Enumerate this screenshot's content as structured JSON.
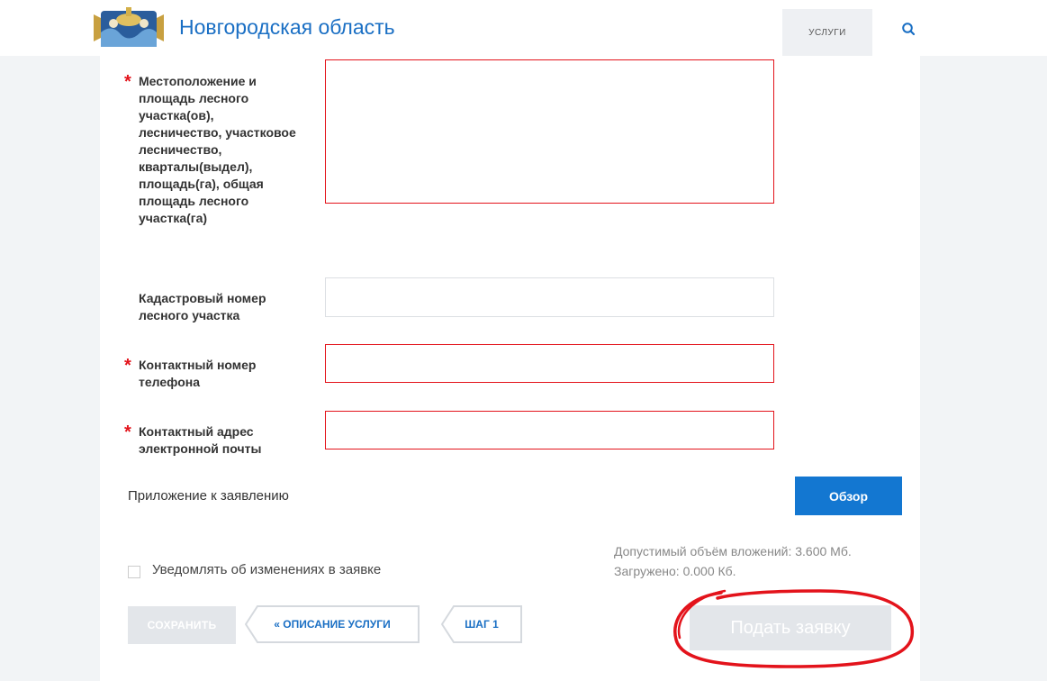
{
  "header": {
    "title": "Новгородская область",
    "services_label": "услуги",
    "logo_icon": "coat-of-arms-icon",
    "search_icon": "search-icon",
    "accent_color": "#1a6fc4"
  },
  "form": {
    "fields": [
      {
        "label": "Местоположение и площадь лесного участка(ов), лесничество, участковое лесничество, кварталы(выдел), площадь(га), общая площадь лесного участка(га)",
        "required": true,
        "value": ""
      },
      {
        "label": "Кадастровый номер лесного участка",
        "required": false,
        "value": ""
      },
      {
        "label": "Контактный номер телефона",
        "required": true,
        "value": ""
      },
      {
        "label": "Контактный адрес электронной почты",
        "required": true,
        "value": ""
      }
    ],
    "required_mark": "*",
    "attachment_label": "Приложение к заявлению",
    "browse_label": "Обзор",
    "attachment_limit": "Допустимый объём вложений: 3.600 Мб.",
    "attachment_loaded": "Загружено: 0.000 Кб.",
    "notify_label": "Уведомлять об изменениях в заявке",
    "notify_checked": false
  },
  "actions": {
    "save_label": "СОХРАНИТЬ",
    "back_description_label": "« ОПИСАНИЕ УСЛУГИ",
    "step_label": "ШАГ 1",
    "submit_label": "Подать заявку"
  }
}
